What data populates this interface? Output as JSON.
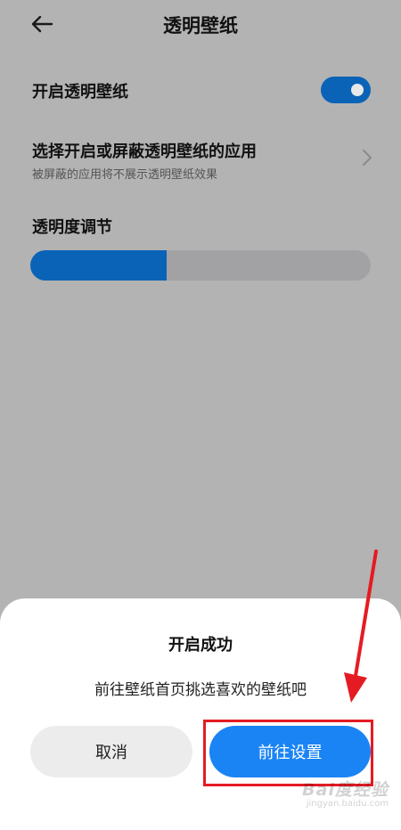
{
  "header": {
    "title": "透明壁纸",
    "back_icon": "back-arrow-icon"
  },
  "settings": {
    "enable": {
      "label": "开启透明壁纸",
      "enabled": true
    },
    "apps": {
      "label": "选择开启或屏蔽透明壁纸的应用",
      "subtitle": "被屏蔽的应用将不展示透明壁纸效果",
      "chevron_icon": "chevron-right-icon"
    },
    "opacity": {
      "label": "透明度调节",
      "value_fraction": 0.4
    }
  },
  "dialog": {
    "title": "开启成功",
    "message": "前往壁纸首页挑选喜欢的壁纸吧",
    "cancel_label": "取消",
    "confirm_label": "前往设置"
  },
  "colors": {
    "accent": "#0a63b7",
    "primary_button": "#1a84f5",
    "annotation_red": "#e51b23",
    "overlay_gray": "#b3b3b3"
  },
  "watermark": {
    "brand": "Bai度经验",
    "url": "jingyan.baidu.com"
  }
}
